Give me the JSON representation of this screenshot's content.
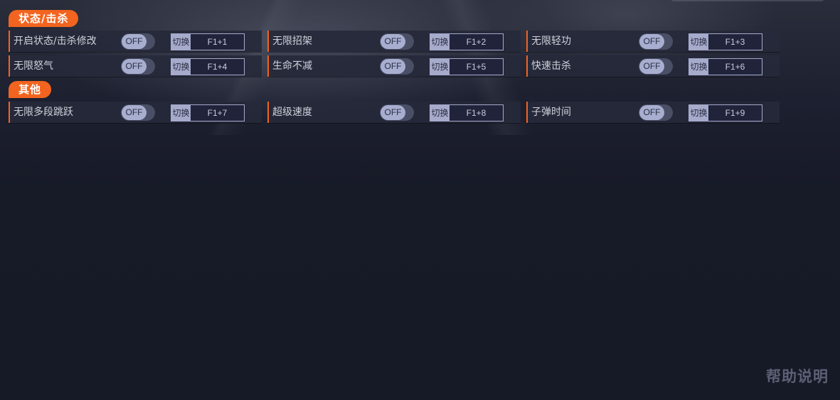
{
  "sections": [
    {
      "title": "状态/击杀",
      "rows": [
        [
          {
            "label": "开启状态/击杀修改",
            "state": "OFF",
            "switch": "切换",
            "key": "F1+1"
          },
          {
            "label": "无限招架",
            "state": "OFF",
            "switch": "切换",
            "key": "F1+2"
          },
          {
            "label": "无限轻功",
            "state": "OFF",
            "switch": "切换",
            "key": "F1+3"
          }
        ],
        [
          {
            "label": "无限怒气",
            "state": "OFF",
            "switch": "切换",
            "key": "F1+4"
          },
          {
            "label": "生命不减",
            "state": "OFF",
            "switch": "切换",
            "key": "F1+5"
          },
          {
            "label": "快速击杀",
            "state": "OFF",
            "switch": "切换",
            "key": "F1+6"
          }
        ]
      ]
    },
    {
      "title": "其他",
      "rows": [
        [
          {
            "label": "无限多段跳跃",
            "state": "OFF",
            "switch": "切换",
            "key": "F1+7"
          },
          {
            "label": "超级速度",
            "state": "OFF",
            "switch": "切换",
            "key": "F1+8"
          },
          {
            "label": "子弹时间",
            "state": "OFF",
            "switch": "切换",
            "key": "F1+9"
          }
        ]
      ]
    }
  ],
  "help_label": "帮助说明",
  "colors": {
    "accent": "#f2641f",
    "toggle_knob": "#a7aed0",
    "row_bg": "#26293a"
  }
}
